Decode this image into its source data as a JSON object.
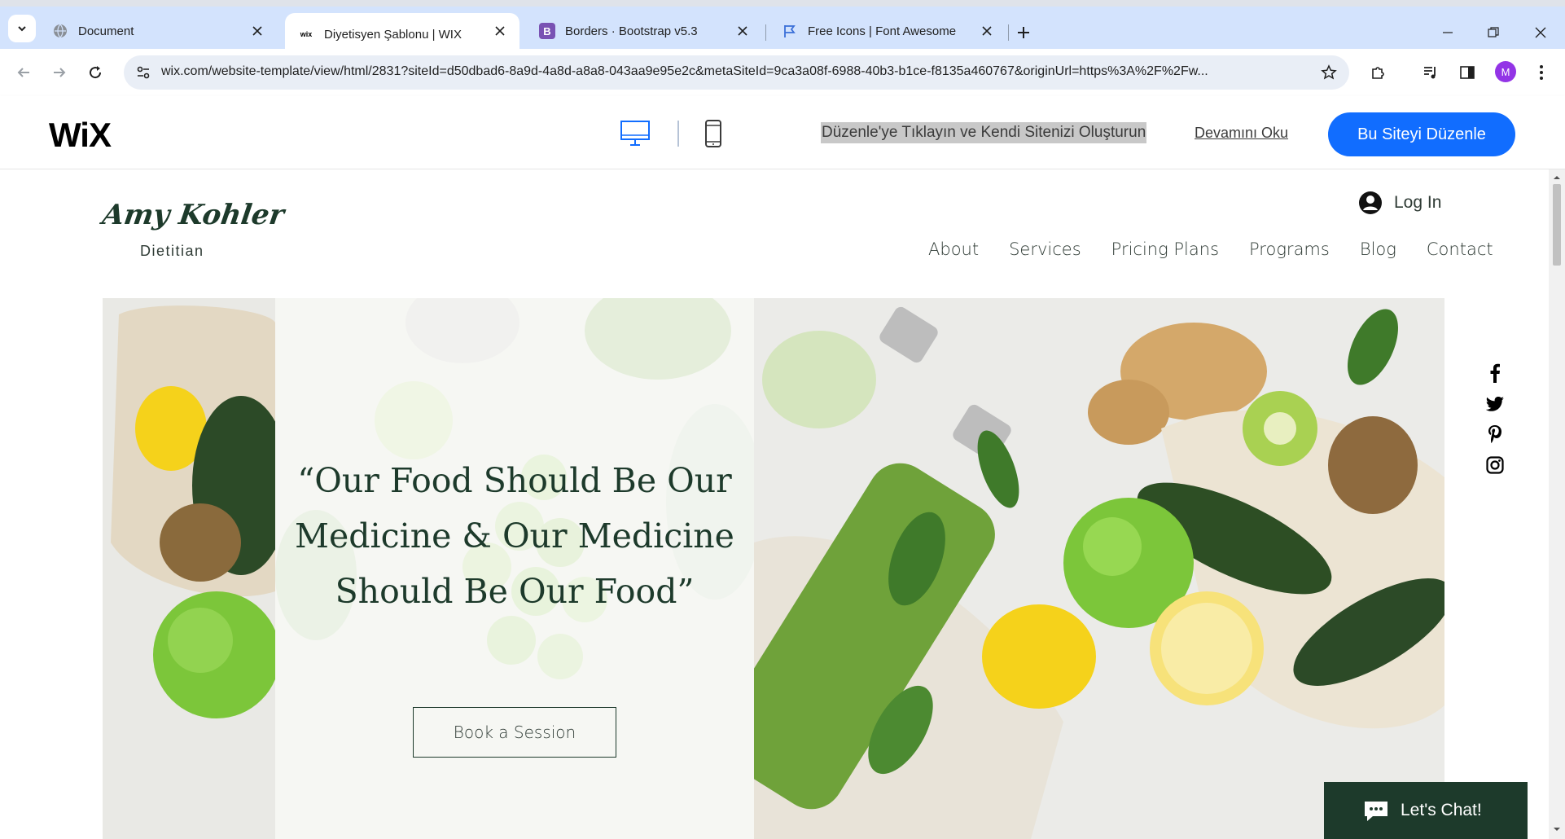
{
  "browser": {
    "tabs": [
      {
        "title": "Document",
        "icon": "globe-icon",
        "active": false
      },
      {
        "title": "Diyetisyen Şablonu | WIX",
        "icon": "wix-favicon-icon",
        "active": true
      },
      {
        "title": "Borders · Bootstrap v5.3",
        "icon": "bootstrap-icon",
        "active": false
      },
      {
        "title": "Free Icons | Font Awesome",
        "icon": "flag-icon",
        "active": false
      }
    ],
    "url": "wix.com/website-template/view/html/2831?siteId=d50dbad6-8a9d-4a8d-a8a8-043aa9e95e2c&metaSiteId=9ca3a08f-6988-40b3-b1ce-f8135a460767&originUrl=https%3A%2F%2Fw...",
    "profile_initial": "M",
    "wix_favicon_text": "wix",
    "bootstrap_letter": "B"
  },
  "wix_bar": {
    "logo": "WiX",
    "promo_text": "Düzenle'ye Tıklayın ve Kendi Sitenizi Oluşturun",
    "read_more": "Devamını Oku",
    "edit_button": "Bu Siteyi Düzenle",
    "accent_color": "#116dff"
  },
  "site": {
    "brand_name": "Amy Kohler",
    "brand_subtitle": "Dietitian",
    "login_label": "Log In",
    "nav": [
      "About",
      "Services",
      "Pricing Plans",
      "Programs",
      "Blog",
      "Contact"
    ],
    "hero": {
      "quote": "“Our Food Should Be Our Medicine & Our Medicine Should Be Our Food”",
      "cta": "Book a Session"
    },
    "social_icons": [
      "facebook-icon",
      "twitter-icon",
      "pinterest-icon",
      "instagram-icon"
    ],
    "chat_label": "Let's Chat!",
    "brand_color": "#1d3a2b"
  }
}
